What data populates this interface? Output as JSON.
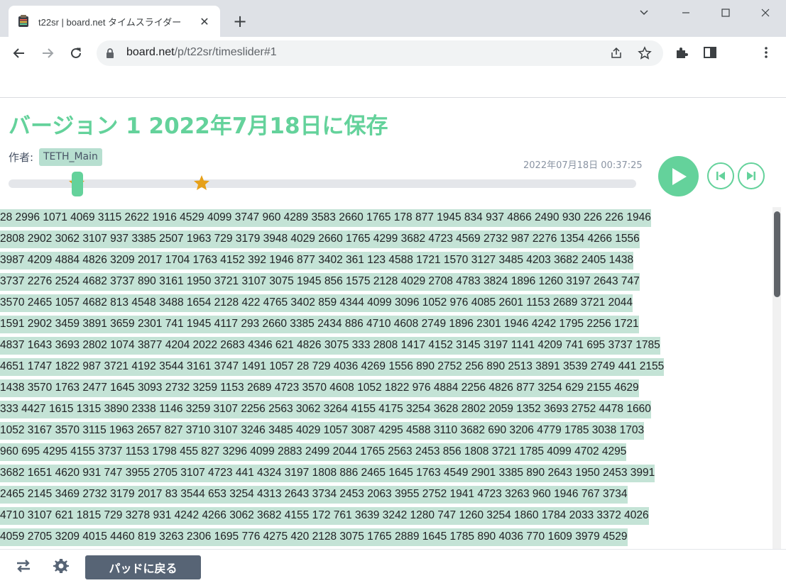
{
  "browser": {
    "tab_title": "t22sr | board.net タイムスライダー",
    "url_host": "board.net",
    "url_path": "/p/t22sr/timeslider#1"
  },
  "page": {
    "title": "バージョン 1 2022年7月18日に保存",
    "author_label": "作者:",
    "author_name": "TETH_Main",
    "timestamp": "2022年07月18日 00:37:25",
    "slider_position": 0.11,
    "back_button": "パッドに戻る"
  },
  "colors": {
    "accent": "#64d29b",
    "highlight": "#c4e3d6",
    "star": "#e6a019",
    "dark_button": "#576475"
  },
  "document_lines": [
    "28 2996 1071 4069 3115 2622 1916 4529 4099 3747 960 4289 3583 2660 1765 178 877 1945 834 937 4866 2490 930 226 226 1946",
    "2808 2902 3062 3107 937 3385 2507 1963 729 3179 3948 4029 2660 1765 4299 3682 4723 4569 2732 987 2276 1354 4266 1556",
    "3987 4209 4884 4826 3209 2017 1704 1763 4152 392 1946 877 3402 361 123 4588 1721 1570 3127 3485 4203 3682 2405 1438",
    "3737 2276 2524 4682 3737 890 3161 1950 3721 3107 3075 1945 856 1575 2128 4029 2708 4783 3824 1896 1260 3197 2643 747",
    "3570 2465 1057 4682 813 4548 3488 1654 2128 422 4765 3402 859 4344 4099 3096 1052 976 4085 2601 1153 2689 3721 2044",
    "1591 2902 3459 3891 3659 2301 741 1945 4117 293 2660 3385 2434 886 4710 4608 2749 1896 2301 1946 4242 1795 2256 1721",
    "4837 1643 3693 2802 1074 3877 4204 2022 2683 4346 621 4826 3075 333 2808 1417 4152 3145 3197 1141 4209 741 695 3737 1785",
    "4651 1747 1822 987 3721 4192 3544 3161 3747 1491 1057 28 729 4036 4269 1556 890 2752 256 890 2513 3891 3539 2749 441 2155",
    "1438 3570 1763 2477 1645 3093 2732 3259 1153 2689 4723 3570 4608 1052 1822 976 4884 2256 4826 877 3254 629 2155 4629",
    "333 4427 1615 1315 3890 2338 1146 3259 3107 2256 2563 3062 3264 4155 4175 3254 3628 2802 2059 1352 3693 2752 4478 1660",
    "1052 3167 3570 3115 1963 2657 827 3710 3107 3246 3485 4029 1057 3087 4295 4588 3110 3682 690 3206 4779 1785 3038 1703",
    "960 695 4295 4155 3737 1153 1798 455 827 3296 4099 2883 2499 2044 1765 2563 2453 856 1808 3721 1785 4099 4702 4295",
    "3682 1651 4620 931 747 3955 2705 3107 4723 441 4324 3197 1808 886 2465 1645 1763 4549 2901 3385 890 2643 1950 2453 3991",
    "2465 2145 3469 2732 3179 2017 83 3544 653 3254 4313 2643 3734 2453 2063 3955 2752 1941 4723 3263 960 1946 767 3734",
    "4710 3107 621 1815 729 3278 931 4242 4266 3062 3682 4155 172 761 3639 3242 1280 747 1260 3254 1860 1784 2033 3372 4026",
    "4059 2705 3209 4015 4460 819 3263 2306 1695 776 4275 420 2128 3075 1765 2889 1645 1785 890 4036 770 1609 3979 4529"
  ]
}
